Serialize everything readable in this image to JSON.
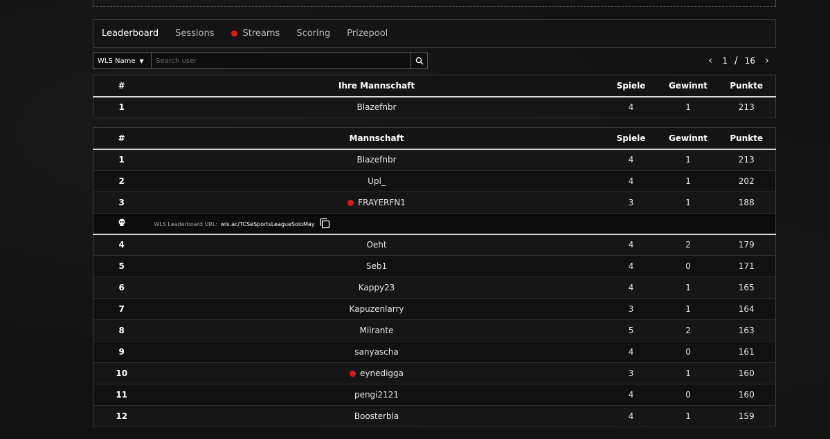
{
  "tabs": [
    {
      "label": "Leaderboard"
    },
    {
      "label": "Sessions"
    },
    {
      "label": "Streams"
    },
    {
      "label": "Scoring"
    },
    {
      "label": "Prizepool"
    }
  ],
  "filter": {
    "selected": "WLS Name"
  },
  "search": {
    "placeholder": "Search user"
  },
  "pagination": {
    "current": "1",
    "separator": "/",
    "total": "16"
  },
  "columns": {
    "rank": "#",
    "team_own": "Ihre Mannschaft",
    "team": "Mannschaft",
    "games": "Spiele",
    "wins": "Gewinnt",
    "points": "Punkte"
  },
  "my_team": {
    "rank": "1",
    "name": "Blazefnbr",
    "games": "4",
    "wins": "1",
    "points": "213"
  },
  "rows": [
    {
      "rank": "1",
      "name": "Blazefnbr",
      "games": "4",
      "wins": "1",
      "points": "213"
    },
    {
      "rank": "2",
      "name": "Upl_",
      "games": "4",
      "wins": "1",
      "points": "202"
    },
    {
      "rank": "3",
      "name": "FRAYERFN1",
      "games": "3",
      "wins": "1",
      "points": "188"
    },
    {
      "rank": "4",
      "name": "Oeht",
      "games": "4",
      "wins": "2",
      "points": "179"
    },
    {
      "rank": "5",
      "name": "Seb1",
      "games": "4",
      "wins": "0",
      "points": "171"
    },
    {
      "rank": "6",
      "name": "Kappy23",
      "games": "4",
      "wins": "1",
      "points": "165"
    },
    {
      "rank": "7",
      "name": "Kapuzenlarry",
      "games": "3",
      "wins": "1",
      "points": "164"
    },
    {
      "rank": "8",
      "name": "Miirante",
      "games": "5",
      "wins": "2",
      "points": "163"
    },
    {
      "rank": "9",
      "name": "sanyascha",
      "games": "4",
      "wins": "0",
      "points": "161"
    },
    {
      "rank": "10",
      "name": "eynedigga",
      "games": "3",
      "wins": "1",
      "points": "160"
    },
    {
      "rank": "11",
      "name": "pengi2121",
      "games": "4",
      "wins": "0",
      "points": "160"
    },
    {
      "rank": "12",
      "name": "Boosterbla",
      "games": "4",
      "wins": "1",
      "points": "159"
    }
  ],
  "info_row": {
    "label": "WLS Leaderboard URL:",
    "url": "wls.ac/TCSeSportsLeagueSoloMay"
  },
  "colors": {
    "live": "#d51a1a",
    "background": "#121212"
  }
}
